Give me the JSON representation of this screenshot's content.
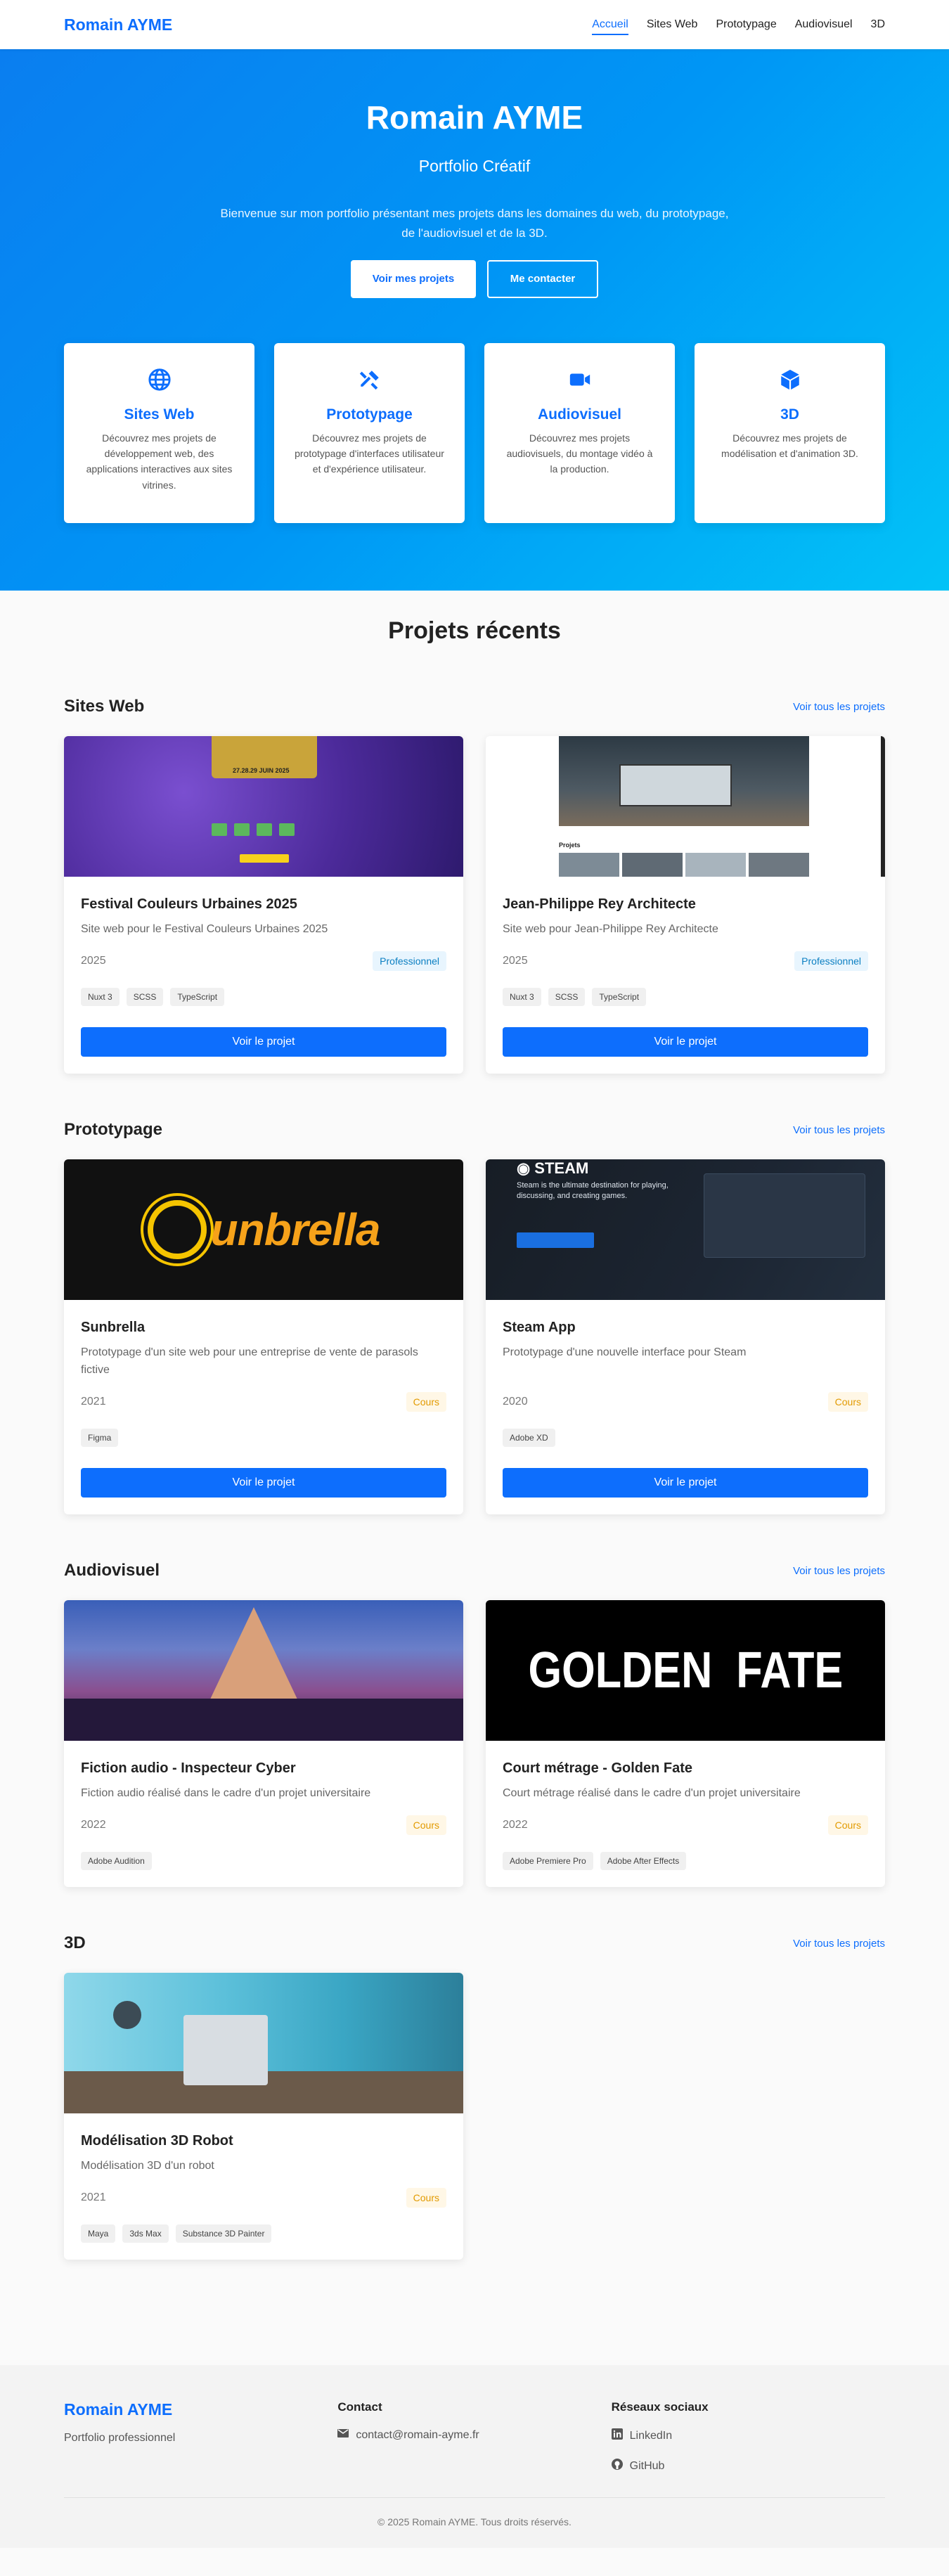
{
  "header": {
    "logo": "Romain AYME",
    "nav": [
      {
        "label": "Accueil"
      },
      {
        "label": "Sites Web"
      },
      {
        "label": "Prototypage"
      },
      {
        "label": "Audiovisuel"
      },
      {
        "label": "3D"
      }
    ]
  },
  "hero": {
    "title": "Romain AYME",
    "subtitle": "Portfolio Créatif",
    "intro": "Bienvenue sur mon portfolio présentant mes projets dans les domaines du web, du prototypage, de l'audiovisuel et de la 3D.",
    "btn_projects": "Voir mes projets",
    "btn_contact": "Me contacter",
    "categories": [
      {
        "icon": "globe-icon",
        "title": "Sites Web",
        "text": "Découvrez mes projets de développement web, des applications interactives aux sites vitrines."
      },
      {
        "icon": "tools-icon",
        "title": "Prototypage",
        "text": "Découvrez mes projets de prototypage d'interfaces utilisateur et d'expérience utilisateur."
      },
      {
        "icon": "video-camera-icon",
        "title": "Audiovisuel",
        "text": "Découvrez mes projets audiovisuels, du montage vidéo à la production."
      },
      {
        "icon": "cube-icon",
        "title": "3D",
        "text": "Découvrez mes projets de modélisation et d'animation 3D."
      }
    ]
  },
  "projects": {
    "title": "Projets récents",
    "see_all": "Voir tous les projets",
    "view_btn": "Voir le projet",
    "web": {
      "title": "Sites Web",
      "items": [
        {
          "name": "Festival Couleurs Urbaines 2025",
          "desc": "Site web pour le Festival Couleurs Urbaines 2025",
          "year": "2025",
          "badge": "Professionnel",
          "tags": [
            "Nuxt 3",
            "SCSS",
            "TypeScript"
          ],
          "thumb_text": "27.28.29 JUIN 2025"
        },
        {
          "name": "Jean-Philippe Rey Architecte",
          "desc": "Site web pour Jean-Philippe Rey Architecte",
          "year": "2025",
          "badge": "Professionnel",
          "tags": [
            "Nuxt 3",
            "SCSS",
            "TypeScript"
          ],
          "thumb_text": "Projets"
        }
      ]
    },
    "proto": {
      "title": "Prototypage",
      "items": [
        {
          "name": "Sunbrella",
          "desc": "Prototypage d'un site web pour une entreprise de vente de parasols fictive",
          "year": "2021",
          "badge": "Cours",
          "tags": [
            "Figma"
          ],
          "thumb_text": "unbrella"
        },
        {
          "name": "Steam App",
          "desc": "Prototypage d'une nouvelle interface pour Steam",
          "year": "2020",
          "badge": "Cours",
          "tags": [
            "Adobe XD"
          ],
          "thumb_text": "Steam is the ultimate destination for playing, discussing, and creating games."
        }
      ]
    },
    "av": {
      "title": "Audiovisuel",
      "items": [
        {
          "name": "Fiction audio - Inspecteur Cyber",
          "desc": "Fiction audio réalisé dans le cadre d'un projet universitaire",
          "year": "2022",
          "badge": "Cours",
          "tags": [
            "Adobe Audition"
          ]
        },
        {
          "name": "Court métrage - Golden Fate",
          "desc": "Court métrage réalisé dans le cadre d'un projet universitaire",
          "year": "2022",
          "badge": "Cours",
          "tags": [
            "Adobe Premiere Pro",
            "Adobe After Effects"
          ],
          "thumb_text": "GOLDEN  FATE"
        }
      ]
    },
    "d3": {
      "title": "3D",
      "items": [
        {
          "name": "Modélisation 3D Robot",
          "desc": "Modélisation 3D d'un robot",
          "year": "2021",
          "badge": "Cours",
          "tags": [
            "Maya",
            "3ds Max",
            "Substance 3D Painter"
          ]
        }
      ]
    }
  },
  "footer": {
    "logo": "Romain AYME",
    "subtitle": "Portfolio professionnel",
    "contact_title": "Contact",
    "email": "contact@romain-ayme.fr",
    "social_title": "Réseaux sociaux",
    "linkedin": "LinkedIn",
    "github": "GitHub",
    "copyright": "© 2025 Romain AYME. Tous droits réservés."
  },
  "colors": {
    "primary": "#0d6efd",
    "hero_start": "#0a7ef0",
    "hero_end": "#02c3f7",
    "badge_pro": "#0b7fc2",
    "badge_cours": "#e29a00"
  }
}
